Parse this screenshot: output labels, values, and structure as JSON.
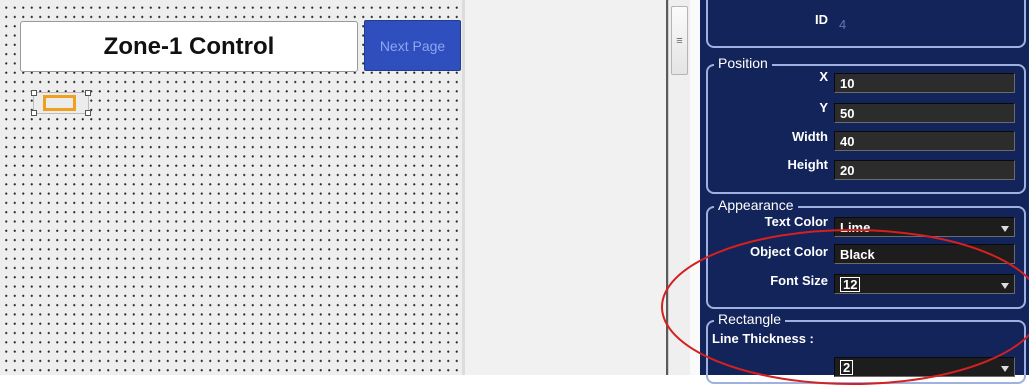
{
  "canvas": {
    "title": "Zone-1 Control",
    "next_button": "Next Page"
  },
  "properties": {
    "id": {
      "label": "ID",
      "value": "4"
    },
    "position": {
      "legend": "Position",
      "x": {
        "label": "X",
        "value": "10"
      },
      "y": {
        "label": "Y",
        "value": "50"
      },
      "width": {
        "label": "Width",
        "value": "40"
      },
      "height": {
        "label": "Height",
        "value": "20"
      }
    },
    "appearance": {
      "legend": "Appearance",
      "text_color": {
        "label": "Text Color",
        "value": "Lime"
      },
      "object_color": {
        "label": "Object Color",
        "value": "Black"
      },
      "font_size": {
        "label": "Font Size",
        "value": "12"
      }
    },
    "rectangle": {
      "legend": "Rectangle",
      "line_thickness": {
        "label": "Line Thickness :",
        "value": "2"
      }
    }
  },
  "colors": {
    "panel_bg": "#13245a",
    "group_border": "#9fb1e0",
    "next_button_bg": "#2f4fbe",
    "selection_accent": "#f0a020",
    "annotation": "#d62020"
  }
}
